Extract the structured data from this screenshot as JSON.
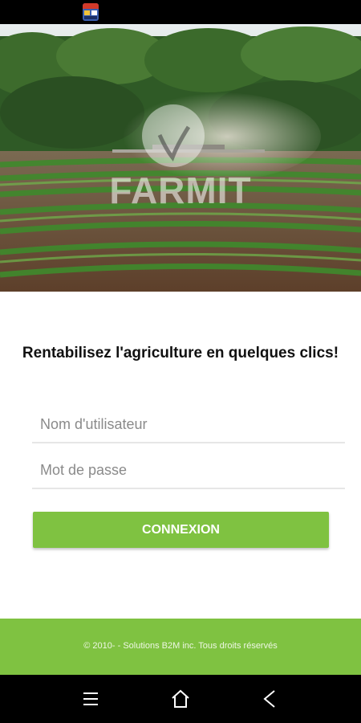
{
  "status_bar": {
    "app_icon": "app-notification-icon"
  },
  "hero": {
    "brand": "FARMIT"
  },
  "tagline": "Rentabilisez l'agriculture en quelques clics!",
  "form": {
    "username_placeholder": "Nom d'utilisateur",
    "password_placeholder": "Mot de passe",
    "login_label": "CONNEXION"
  },
  "footer": {
    "copyright": "© 2010- - Solutions B2M inc. Tous droits réservés"
  },
  "nav_bar": {
    "icons": [
      "recents-icon",
      "home-icon",
      "back-icon"
    ]
  },
  "colors": {
    "accent": "#7fc241",
    "footer_bg": "#7fc241",
    "text_dark": "#111111"
  }
}
